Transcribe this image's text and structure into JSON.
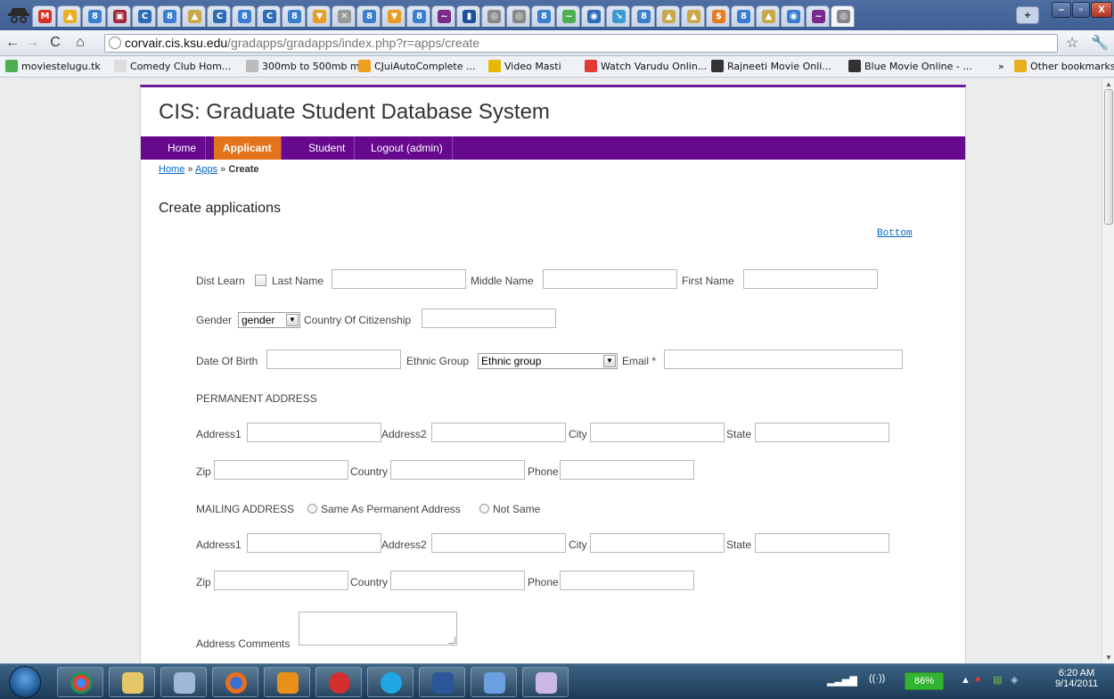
{
  "browser": {
    "url_host": "corvair.cis.ksu.edu",
    "url_path": "/gradapps/gradapps/index.php?r=apps/create",
    "bookmarks": [
      "moviestelugu.tk",
      "Comedy Club Hom...",
      "300mb to 500mb m...",
      "CJuiAutoComplete ...",
      "Video Masti",
      "Watch Varudu Onlin...",
      "Rajneeti Movie Onli...",
      "Blue Movie Online - ...",
      "Other bookmarks"
    ]
  },
  "site": {
    "title": "CIS: Graduate Student Database System",
    "menu": [
      {
        "label": "Home",
        "active": false
      },
      {
        "label": "Applicant",
        "active": true
      },
      {
        "label": "Student",
        "active": false
      },
      {
        "label": "Logout (admin)",
        "active": false
      }
    ],
    "breadcrumb": {
      "home": "Home",
      "sep": "»",
      "apps": "Apps",
      "current": "Create"
    },
    "heading": "Create applications",
    "bottom_link": "Bottom"
  },
  "form": {
    "dist_learn": "Dist Learn",
    "last_name": "Last Name",
    "middle_name": "Middle Name",
    "first_name": "First Name",
    "gender": "Gender",
    "gender_value": "gender",
    "country_citizenship": "Country Of Citizenship",
    "dob": "Date Of Birth",
    "ethnic_group": "Ethnic Group",
    "ethnic_value": "Ethnic group",
    "email": "Email *",
    "permanent_address": "PERMANENT ADDRESS",
    "address1": "Address1",
    "address2": "Address2",
    "city": "City",
    "state": "State",
    "zip": "Zip",
    "country": "Country",
    "phone": "Phone",
    "mailing_address": "MAILING ADDRESS",
    "same_as_permanent": "Same As Permanent Address",
    "not_same": "Not Same",
    "address_comments": "Address Comments"
  },
  "taskbar": {
    "battery": "86%",
    "time": "6:20 AM",
    "date": "9/14/2011"
  }
}
